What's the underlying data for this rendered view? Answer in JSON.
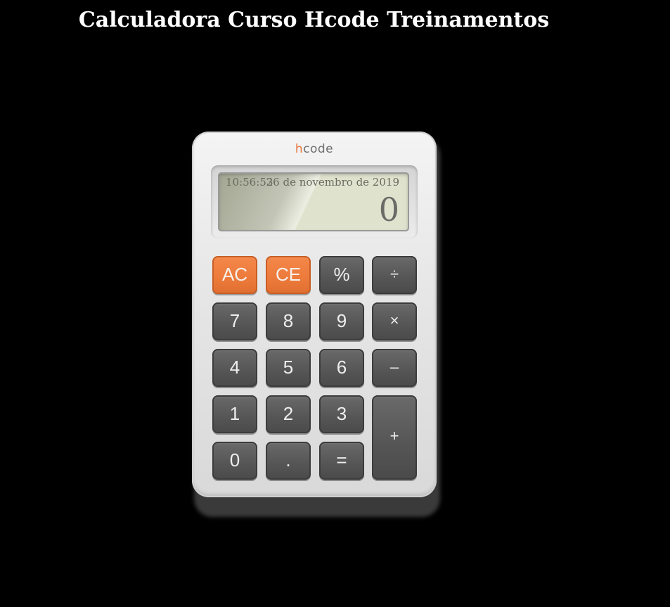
{
  "page": {
    "title": "Calculadora Curso Hcode Treinamentos"
  },
  "calculator": {
    "brand_accent": "h",
    "brand_rest": "code",
    "display": {
      "time": "10:56:53",
      "date": "26 de novembro de 2019",
      "value": "0"
    },
    "buttons": {
      "ac": "AC",
      "ce": "CE",
      "percent": "%",
      "divide": "÷",
      "seven": "7",
      "eight": "8",
      "nine": "9",
      "multiply": "×",
      "four": "4",
      "five": "5",
      "six": "6",
      "subtract": "–",
      "one": "1",
      "two": "2",
      "three": "3",
      "add": "+",
      "zero": "0",
      "dot": ".",
      "equals": "="
    }
  },
  "colors": {
    "background": "#000000",
    "accent": "#ec7a3b",
    "key": "#555555",
    "lcd": "#dfe2cd"
  }
}
